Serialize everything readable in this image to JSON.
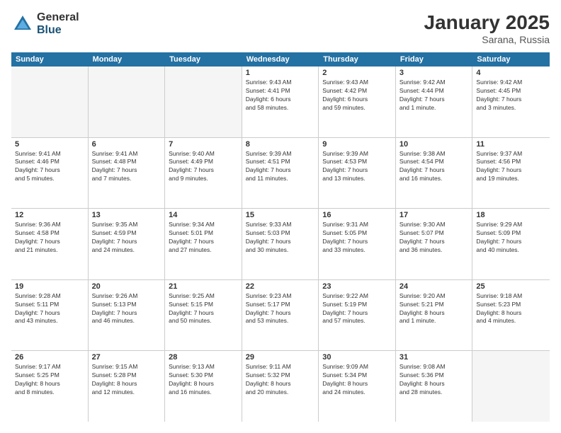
{
  "logo": {
    "general": "General",
    "blue": "Blue"
  },
  "title": "January 2025",
  "location": "Sarana, Russia",
  "days_of_week": [
    "Sunday",
    "Monday",
    "Tuesday",
    "Wednesday",
    "Thursday",
    "Friday",
    "Saturday"
  ],
  "weeks": [
    [
      {
        "day": "",
        "info": ""
      },
      {
        "day": "",
        "info": ""
      },
      {
        "day": "",
        "info": ""
      },
      {
        "day": "1",
        "info": "Sunrise: 9:43 AM\nSunset: 4:41 PM\nDaylight: 6 hours\nand 58 minutes."
      },
      {
        "day": "2",
        "info": "Sunrise: 9:43 AM\nSunset: 4:42 PM\nDaylight: 6 hours\nand 59 minutes."
      },
      {
        "day": "3",
        "info": "Sunrise: 9:42 AM\nSunset: 4:44 PM\nDaylight: 7 hours\nand 1 minute."
      },
      {
        "day": "4",
        "info": "Sunrise: 9:42 AM\nSunset: 4:45 PM\nDaylight: 7 hours\nand 3 minutes."
      }
    ],
    [
      {
        "day": "5",
        "info": "Sunrise: 9:41 AM\nSunset: 4:46 PM\nDaylight: 7 hours\nand 5 minutes."
      },
      {
        "day": "6",
        "info": "Sunrise: 9:41 AM\nSunset: 4:48 PM\nDaylight: 7 hours\nand 7 minutes."
      },
      {
        "day": "7",
        "info": "Sunrise: 9:40 AM\nSunset: 4:49 PM\nDaylight: 7 hours\nand 9 minutes."
      },
      {
        "day": "8",
        "info": "Sunrise: 9:39 AM\nSunset: 4:51 PM\nDaylight: 7 hours\nand 11 minutes."
      },
      {
        "day": "9",
        "info": "Sunrise: 9:39 AM\nSunset: 4:53 PM\nDaylight: 7 hours\nand 13 minutes."
      },
      {
        "day": "10",
        "info": "Sunrise: 9:38 AM\nSunset: 4:54 PM\nDaylight: 7 hours\nand 16 minutes."
      },
      {
        "day": "11",
        "info": "Sunrise: 9:37 AM\nSunset: 4:56 PM\nDaylight: 7 hours\nand 19 minutes."
      }
    ],
    [
      {
        "day": "12",
        "info": "Sunrise: 9:36 AM\nSunset: 4:58 PM\nDaylight: 7 hours\nand 21 minutes."
      },
      {
        "day": "13",
        "info": "Sunrise: 9:35 AM\nSunset: 4:59 PM\nDaylight: 7 hours\nand 24 minutes."
      },
      {
        "day": "14",
        "info": "Sunrise: 9:34 AM\nSunset: 5:01 PM\nDaylight: 7 hours\nand 27 minutes."
      },
      {
        "day": "15",
        "info": "Sunrise: 9:33 AM\nSunset: 5:03 PM\nDaylight: 7 hours\nand 30 minutes."
      },
      {
        "day": "16",
        "info": "Sunrise: 9:31 AM\nSunset: 5:05 PM\nDaylight: 7 hours\nand 33 minutes."
      },
      {
        "day": "17",
        "info": "Sunrise: 9:30 AM\nSunset: 5:07 PM\nDaylight: 7 hours\nand 36 minutes."
      },
      {
        "day": "18",
        "info": "Sunrise: 9:29 AM\nSunset: 5:09 PM\nDaylight: 7 hours\nand 40 minutes."
      }
    ],
    [
      {
        "day": "19",
        "info": "Sunrise: 9:28 AM\nSunset: 5:11 PM\nDaylight: 7 hours\nand 43 minutes."
      },
      {
        "day": "20",
        "info": "Sunrise: 9:26 AM\nSunset: 5:13 PM\nDaylight: 7 hours\nand 46 minutes."
      },
      {
        "day": "21",
        "info": "Sunrise: 9:25 AM\nSunset: 5:15 PM\nDaylight: 7 hours\nand 50 minutes."
      },
      {
        "day": "22",
        "info": "Sunrise: 9:23 AM\nSunset: 5:17 PM\nDaylight: 7 hours\nand 53 minutes."
      },
      {
        "day": "23",
        "info": "Sunrise: 9:22 AM\nSunset: 5:19 PM\nDaylight: 7 hours\nand 57 minutes."
      },
      {
        "day": "24",
        "info": "Sunrise: 9:20 AM\nSunset: 5:21 PM\nDaylight: 8 hours\nand 1 minute."
      },
      {
        "day": "25",
        "info": "Sunrise: 9:18 AM\nSunset: 5:23 PM\nDaylight: 8 hours\nand 4 minutes."
      }
    ],
    [
      {
        "day": "26",
        "info": "Sunrise: 9:17 AM\nSunset: 5:25 PM\nDaylight: 8 hours\nand 8 minutes."
      },
      {
        "day": "27",
        "info": "Sunrise: 9:15 AM\nSunset: 5:28 PM\nDaylight: 8 hours\nand 12 minutes."
      },
      {
        "day": "28",
        "info": "Sunrise: 9:13 AM\nSunset: 5:30 PM\nDaylight: 8 hours\nand 16 minutes."
      },
      {
        "day": "29",
        "info": "Sunrise: 9:11 AM\nSunset: 5:32 PM\nDaylight: 8 hours\nand 20 minutes."
      },
      {
        "day": "30",
        "info": "Sunrise: 9:09 AM\nSunset: 5:34 PM\nDaylight: 8 hours\nand 24 minutes."
      },
      {
        "day": "31",
        "info": "Sunrise: 9:08 AM\nSunset: 5:36 PM\nDaylight: 8 hours\nand 28 minutes."
      },
      {
        "day": "",
        "info": ""
      }
    ]
  ]
}
